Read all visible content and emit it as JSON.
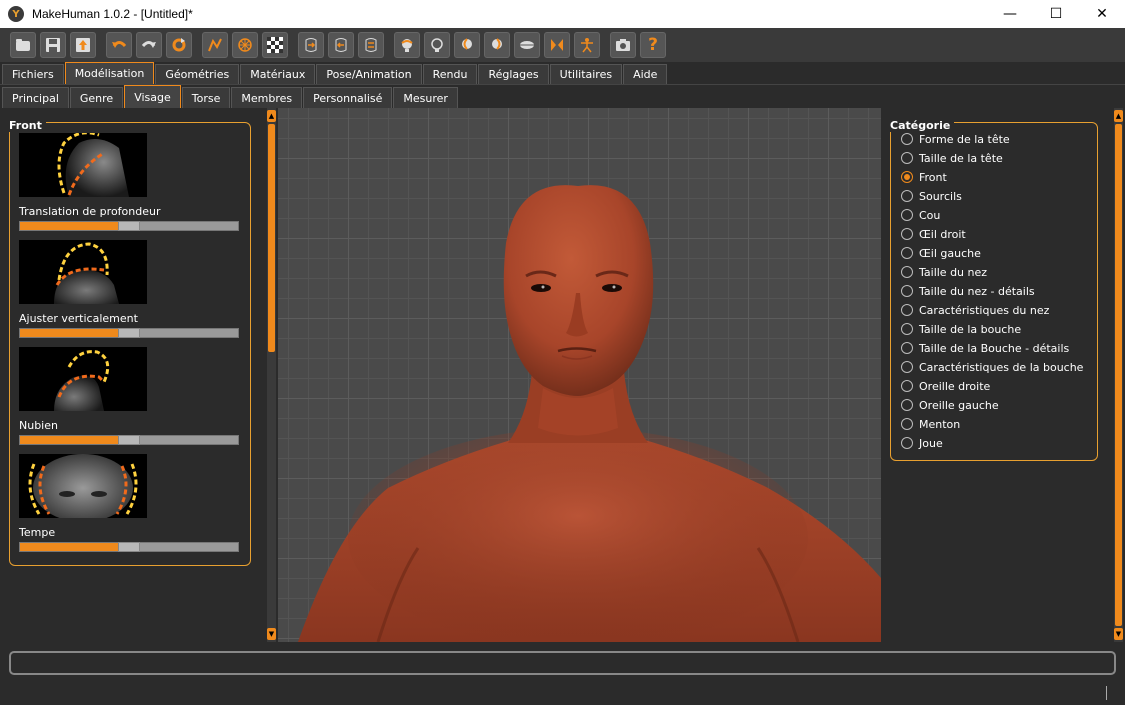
{
  "window": {
    "title": "MakeHuman 1.0.2 - [Untitled]*",
    "controls": {
      "minimize": "—",
      "maximize": "☐",
      "close": "✕"
    }
  },
  "toolbar": {
    "icons": [
      "open-icon",
      "save-icon",
      "export-icon",
      "undo-icon",
      "redo-icon",
      "reset-icon",
      "wireframe-icon",
      "smooth-icon",
      "background-icon",
      "front-view-icon",
      "back-view-icon",
      "left-view-icon",
      "right-view-icon",
      "top-view-icon",
      "bottom-view-icon",
      "reset-camera-icon",
      "symmetry-icon",
      "skeleton-icon",
      "screenshot-icon",
      "help-icon"
    ]
  },
  "main_tabs": [
    {
      "label": "Fichiers",
      "active": false
    },
    {
      "label": "Modélisation",
      "active": true
    },
    {
      "label": "Géométries",
      "active": false
    },
    {
      "label": "Matériaux",
      "active": false
    },
    {
      "label": "Pose/Animation",
      "active": false
    },
    {
      "label": "Rendu",
      "active": false
    },
    {
      "label": "Réglages",
      "active": false
    },
    {
      "label": "Utilitaires",
      "active": false
    },
    {
      "label": "Aide",
      "active": false
    }
  ],
  "sub_tabs": [
    {
      "label": "Principal",
      "active": false
    },
    {
      "label": "Genre",
      "active": false
    },
    {
      "label": "Visage",
      "active": true
    },
    {
      "label": "Torse",
      "active": false
    },
    {
      "label": "Membres",
      "active": false
    },
    {
      "label": "Personnalisé",
      "active": false
    },
    {
      "label": "Mesurer",
      "active": false
    }
  ],
  "left_panel": {
    "title": "Front",
    "sliders": [
      {
        "label": "Translation de profondeur",
        "value": 0.5
      },
      {
        "label": "Ajuster verticalement",
        "value": 0.5
      },
      {
        "label": "Nubien",
        "value": 0.5
      },
      {
        "label": "Tempe",
        "value": 0.5
      }
    ]
  },
  "right_panel": {
    "title": "Catégorie",
    "options": [
      {
        "label": "Forme de la tête",
        "checked": false
      },
      {
        "label": "Taille de la tête",
        "checked": false
      },
      {
        "label": "Front",
        "checked": true
      },
      {
        "label": "Sourcils",
        "checked": false
      },
      {
        "label": "Cou",
        "checked": false
      },
      {
        "label": "Œil droit",
        "checked": false
      },
      {
        "label": "Œil gauche",
        "checked": false
      },
      {
        "label": "Taille du nez",
        "checked": false
      },
      {
        "label": "Taille du nez - détails",
        "checked": false
      },
      {
        "label": "Caractéristiques du nez",
        "checked": false
      },
      {
        "label": "Taille de la bouche",
        "checked": false
      },
      {
        "label": "Taille de la Bouche - détails",
        "checked": false
      },
      {
        "label": "Caractéristiques de la bouche",
        "checked": false
      },
      {
        "label": "Oreille droite",
        "checked": false
      },
      {
        "label": "Oreille gauche",
        "checked": false
      },
      {
        "label": "Menton",
        "checked": false
      },
      {
        "label": "Joue",
        "checked": false
      }
    ]
  },
  "colors": {
    "accent": "#f08a1c",
    "background": "#2b2b2b",
    "skin": "#a8452a"
  }
}
